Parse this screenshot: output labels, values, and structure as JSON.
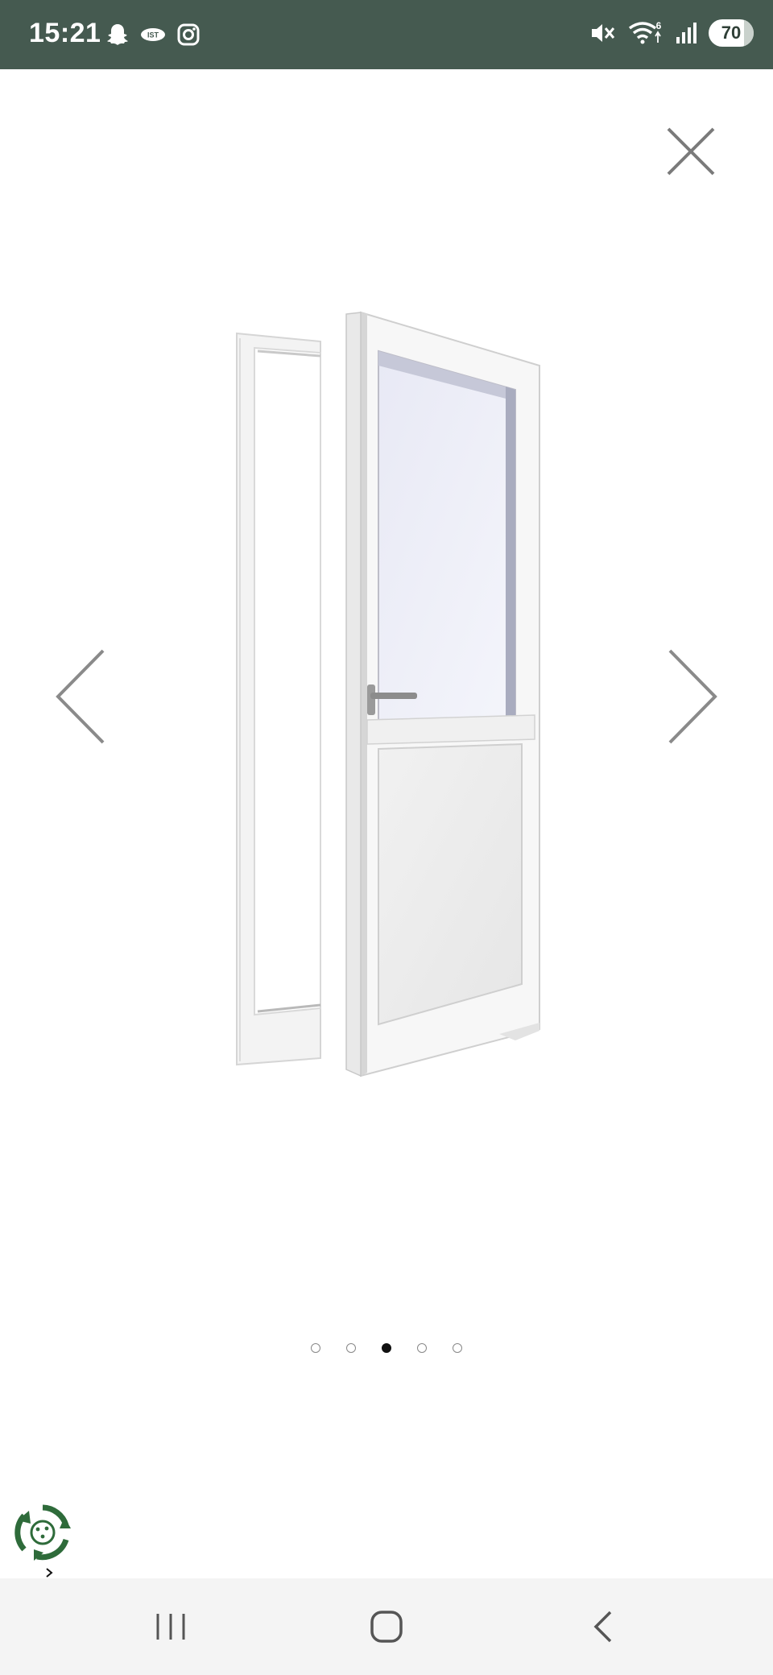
{
  "status_bar": {
    "time": "15:21",
    "battery_level": "70",
    "background_color": "#455a50",
    "left_icons": [
      "snapchat-icon",
      "ist-badge-icon",
      "instagram-icon"
    ],
    "right_icons": [
      "mute-vibrate-icon",
      "wifi-icon",
      "signal-icon"
    ],
    "wifi_label": "6"
  },
  "gallery": {
    "image_description": "white-pvc-door-half-glazed",
    "total_slides": 5,
    "active_slide": 3,
    "close_icon": "close-icon",
    "prev_icon": "chevron-left-icon",
    "next_icon": "chevron-right-icon"
  },
  "widget": {
    "icon": "recycle-widget-icon",
    "color": "#2e6b3a"
  },
  "nav_bar": {
    "buttons": [
      "recent-apps-icon",
      "home-icon",
      "back-icon"
    ]
  }
}
